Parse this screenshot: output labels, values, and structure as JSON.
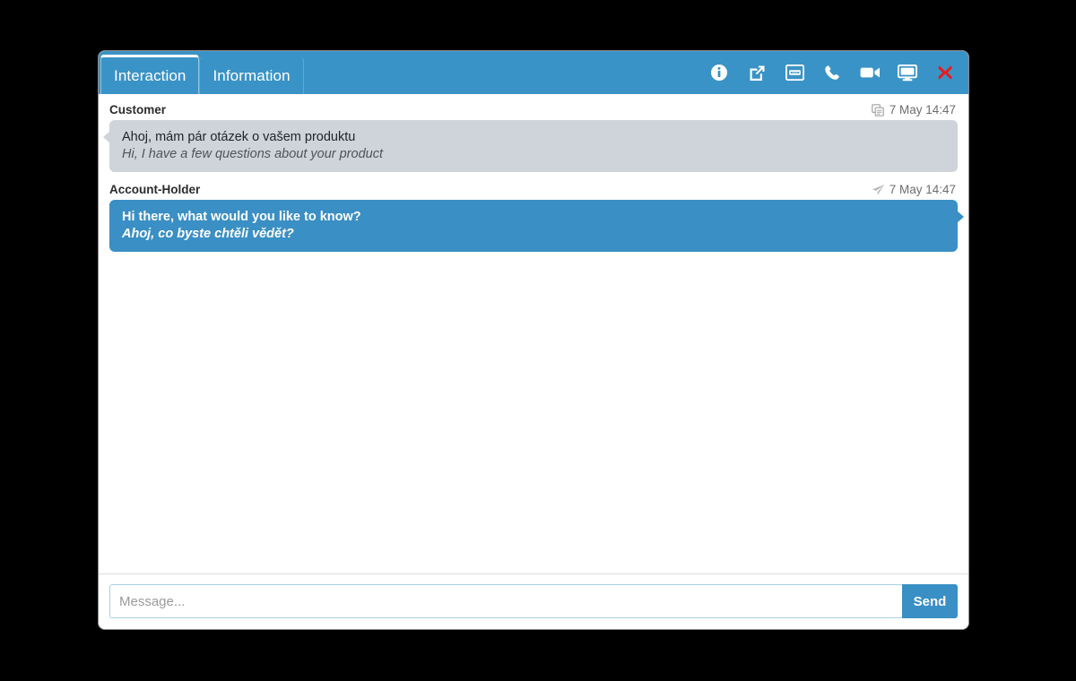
{
  "window": {
    "tabs": [
      {
        "label": "Interaction",
        "name": "tab-interaction",
        "active": true
      },
      {
        "label": "Information",
        "name": "tab-information",
        "active": false
      }
    ],
    "actions": [
      {
        "label": "Info",
        "icon": "info-circle-icon"
      },
      {
        "label": "Pop out",
        "icon": "external-link-icon"
      },
      {
        "label": "Transfer",
        "icon": "transfer-window-icon"
      },
      {
        "label": "Voice call",
        "icon": "phone-icon"
      },
      {
        "label": "Video call",
        "icon": "video-camera-icon"
      },
      {
        "label": "Screen share",
        "icon": "desktop-monitor-icon"
      },
      {
        "label": "Close",
        "icon": "close-x-icon"
      }
    ]
  },
  "colors": {
    "header_blue": "#3a93c6",
    "agent_bubble": "#3a8fc4",
    "customer_bubble": "#ced4da",
    "close_red": "#e81b1b",
    "send_button": "#3a8fc4"
  },
  "transcript": [
    {
      "author": "Customer",
      "timestamp": "7 May 14:47",
      "stamp_icon": "chat-copy-icon",
      "side": "left",
      "original": "Ahoj, mám pár otázek o vašem produktu",
      "translation": "Hi, I have a few questions about your product"
    },
    {
      "author": "Account-Holder",
      "timestamp": "7 May 14:47",
      "stamp_icon": "paper-plane-icon",
      "side": "right",
      "original": "Hi there, what would you like to know?",
      "translation": "Ahoj, co byste chtěli vědět?"
    }
  ],
  "composer": {
    "placeholder": "Message...",
    "value": "",
    "send_label": "Send"
  }
}
